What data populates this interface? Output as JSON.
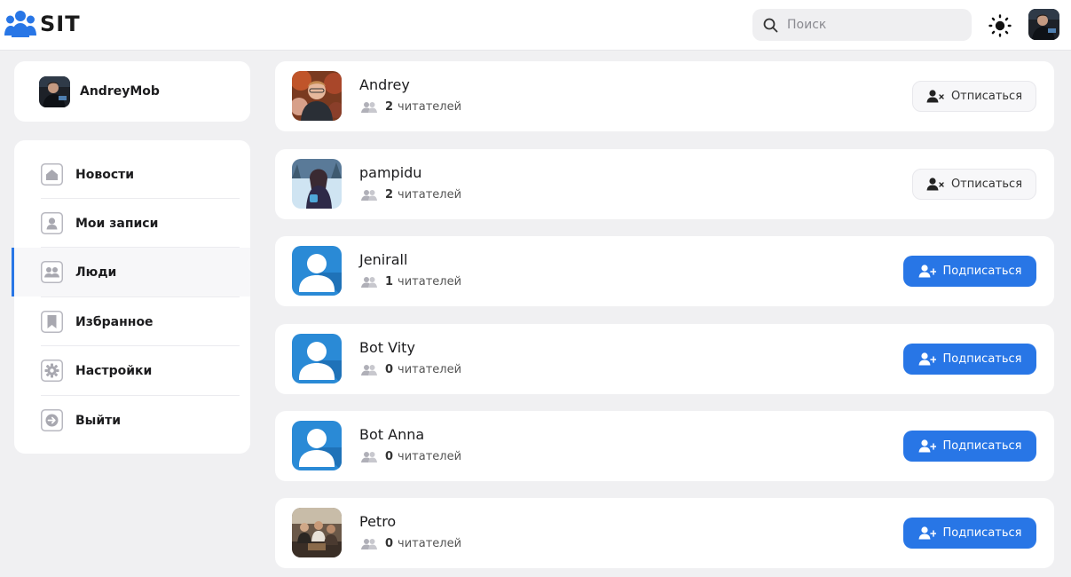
{
  "app": {
    "logo_text": "SIT",
    "search_placeholder": "Поиск"
  },
  "profile": {
    "username": "AndreyMob"
  },
  "menu": [
    {
      "label": "Новости",
      "icon": "home-icon"
    },
    {
      "label": "Мои записи",
      "icon": "user-icon"
    },
    {
      "label": "Люди",
      "icon": "people-icon",
      "active": true
    },
    {
      "label": "Избранное",
      "icon": "bookmark-icon"
    },
    {
      "label": "Настройки",
      "icon": "gear-icon"
    },
    {
      "label": "Выйти",
      "icon": "logout-icon"
    }
  ],
  "people": [
    {
      "name": "Andrey",
      "followers": "2",
      "followers_label": "читателей",
      "action": "Отписаться",
      "subscribed": true
    },
    {
      "name": "pampidu",
      "followers": "2",
      "followers_label": "читателей",
      "action": "Отписаться",
      "subscribed": true
    },
    {
      "name": "Jenirall",
      "followers": "1",
      "followers_label": "читателей",
      "action": "Подписаться",
      "subscribed": false
    },
    {
      "name": "Bot Vity",
      "followers": "0",
      "followers_label": "читателей",
      "action": "Подписаться",
      "subscribed": false
    },
    {
      "name": "Bot Anna",
      "followers": "0",
      "followers_label": "читателей",
      "action": "Подписаться",
      "subscribed": false
    },
    {
      "name": "Petro",
      "followers": "0",
      "followers_label": "читателей",
      "action": "Подписаться",
      "subscribed": false
    }
  ],
  "colors": {
    "accent": "#2876e6",
    "background": "#f0f0f2",
    "card": "#ffffff"
  }
}
